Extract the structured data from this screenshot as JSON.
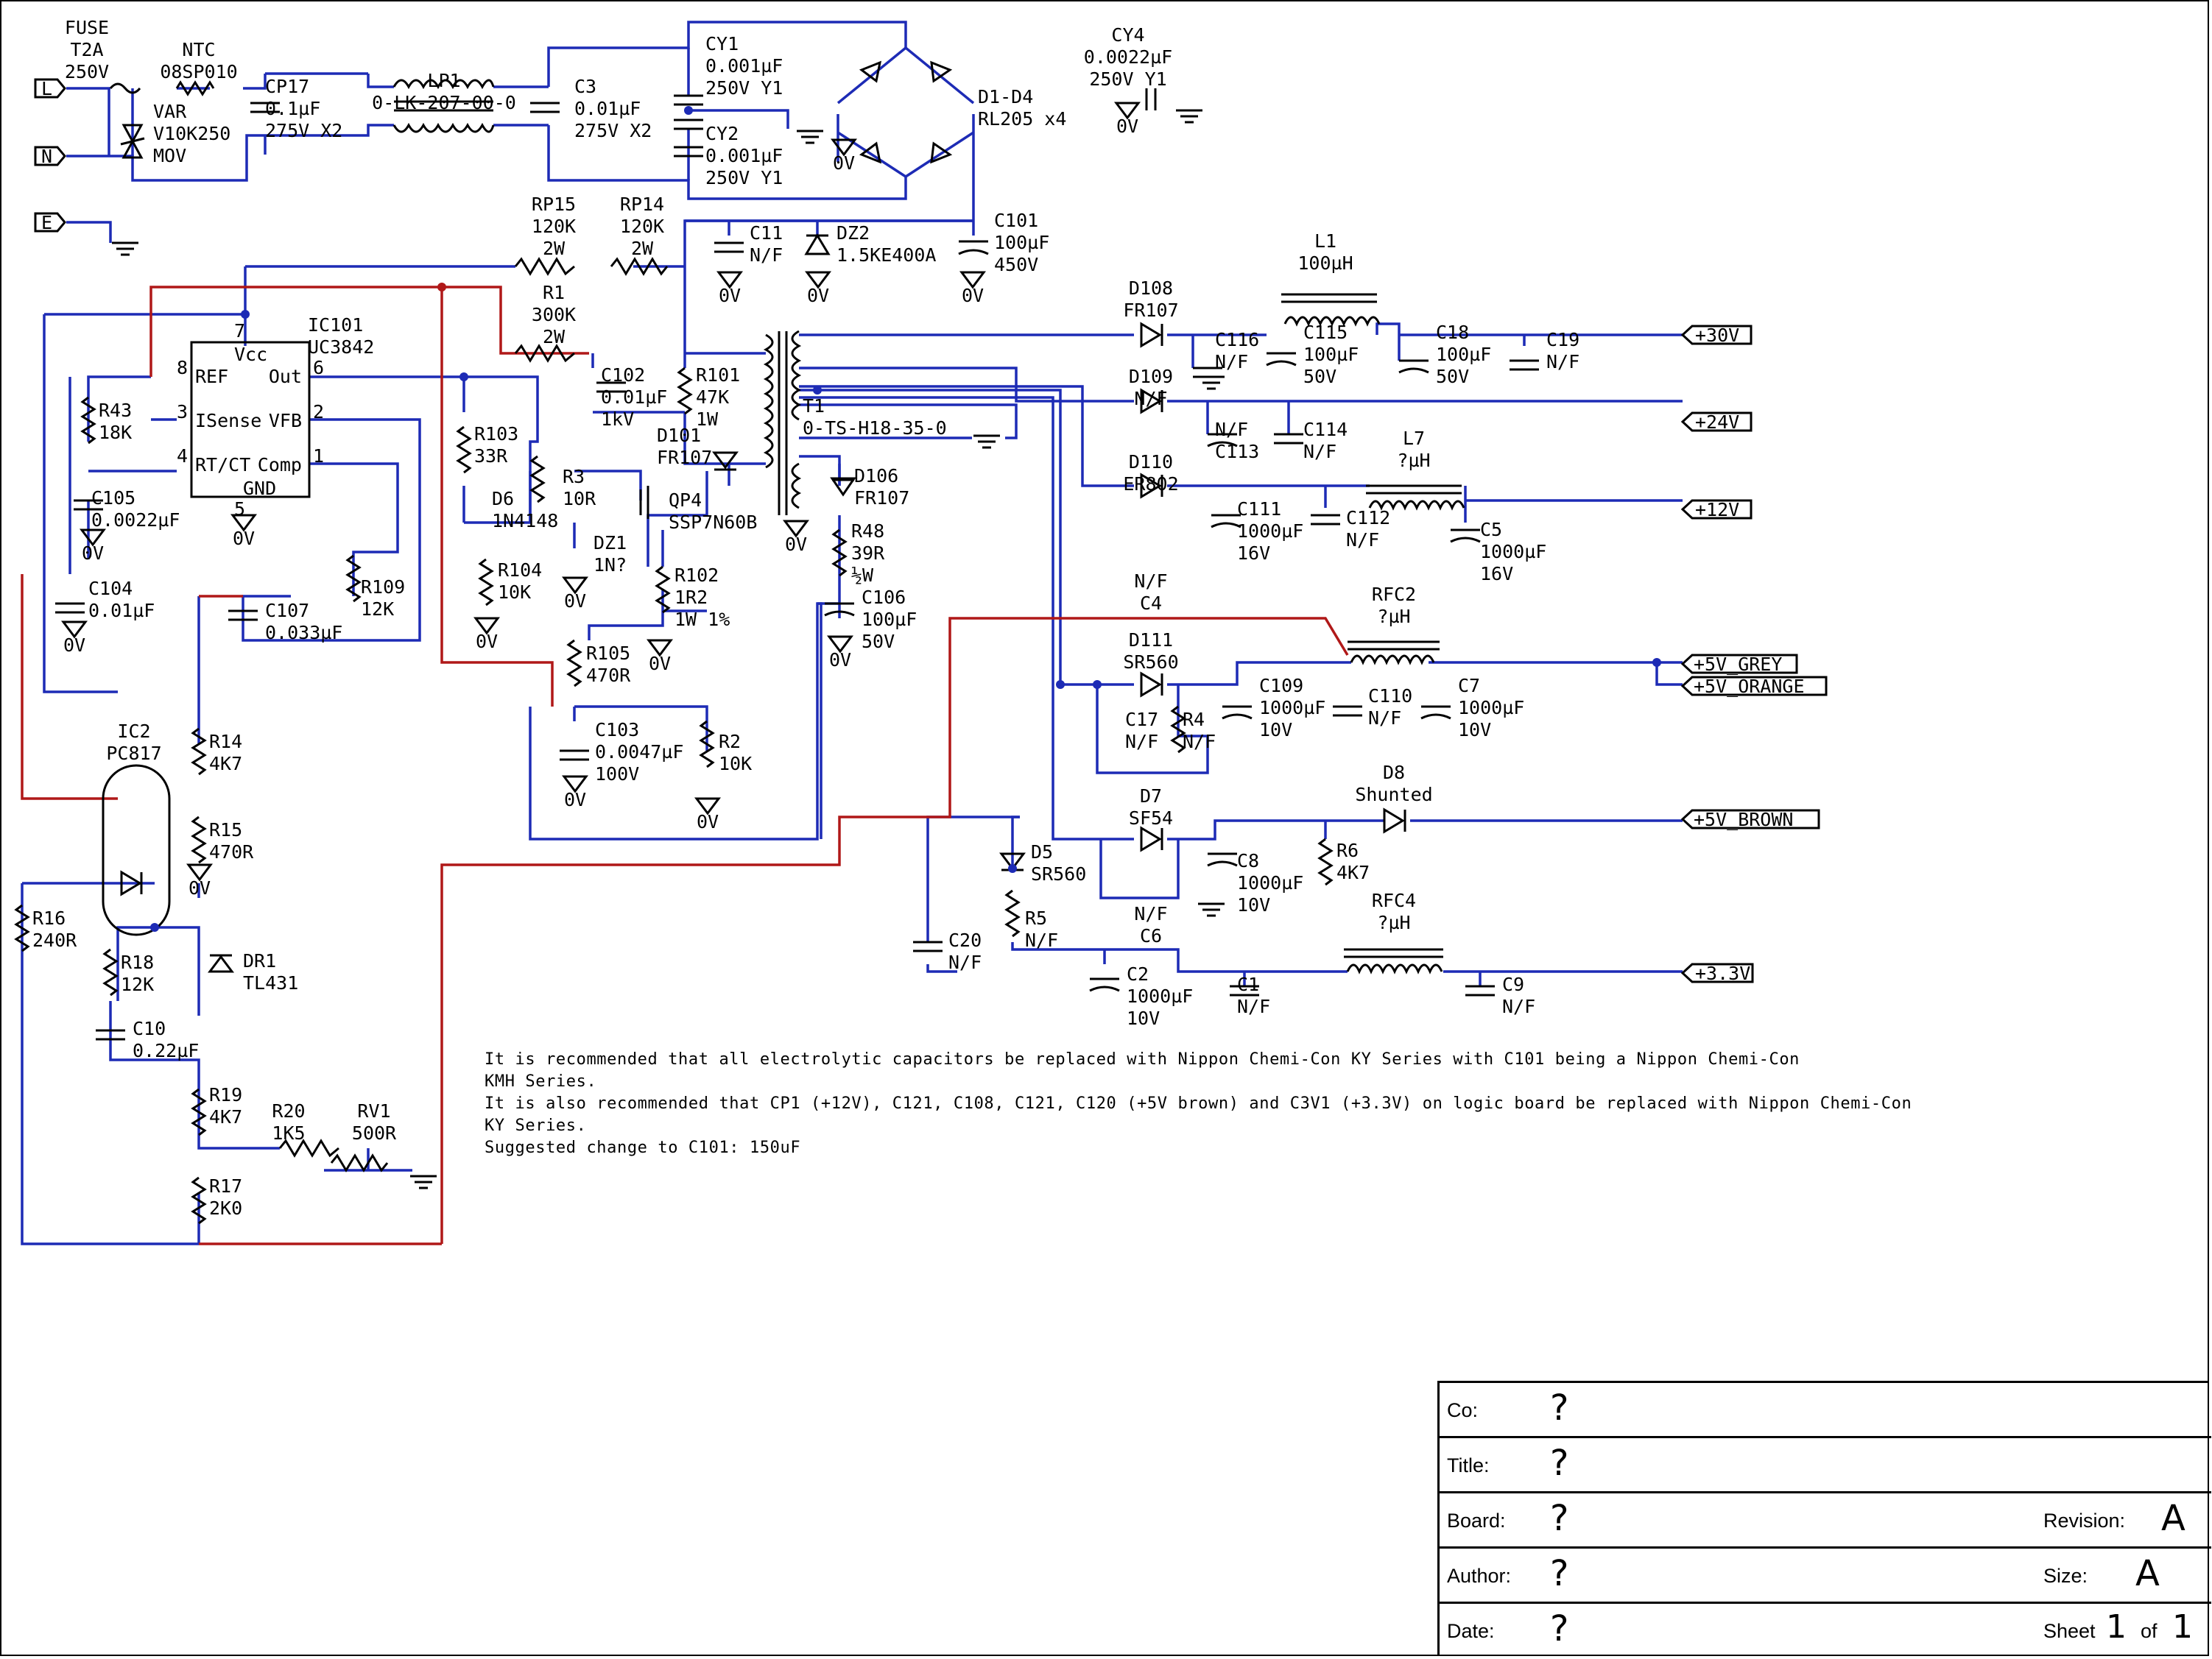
{
  "input": {
    "live": "L",
    "neutral": "N",
    "earth": "E"
  },
  "parts": {
    "fuse": [
      "FUSE",
      "T2A",
      "250V"
    ],
    "ntc": [
      "NTC",
      "08SP010"
    ],
    "var": [
      "VAR",
      "V10K250",
      "MOV"
    ],
    "cp17": [
      "CP17",
      "0.1µF",
      "275V X2"
    ],
    "lp1": [
      "LP1",
      "0-LK-207-00-0"
    ],
    "c3": [
      "C3",
      "0.01µF",
      "275V X2"
    ],
    "cy1": [
      "CY1",
      "0.001µF",
      "250V Y1"
    ],
    "cy2": [
      "CY2",
      "0.001µF",
      "250V Y1"
    ],
    "cy4": [
      "CY4",
      "0.0022µF",
      "250V Y1"
    ],
    "d1d4": [
      "D1-D4",
      "RL205 x4"
    ],
    "rp15": [
      "RP15",
      "120K",
      "2W"
    ],
    "rp14": [
      "RP14",
      "120K",
      "2W"
    ],
    "c11": [
      "C11",
      "N/F"
    ],
    "dz2": [
      "DZ2",
      "1.5KE400A"
    ],
    "c101": [
      "C101",
      "100µF",
      "450V"
    ],
    "r1": [
      "R1",
      "300K",
      "2W"
    ],
    "ic101": [
      "IC101",
      "UC3842"
    ],
    "ic_pins": [
      "Vcc",
      "REF",
      "Out",
      "ISense",
      "VFB",
      "RT/CT",
      "Comp",
      "GND",
      "7",
      "8",
      "6",
      "3",
      "2",
      "4",
      "1",
      "5"
    ],
    "r43": [
      "R43",
      "18K"
    ],
    "c105": [
      "C105",
      "0.0022µF"
    ],
    "c104": [
      "C104",
      "0.01µF"
    ],
    "c107": [
      "C107",
      "0.033µF"
    ],
    "r109": [
      "R109",
      "12K"
    ],
    "r103": [
      "R103",
      "33R"
    ],
    "d6": [
      "D6",
      "1N4148"
    ],
    "r3": [
      "R3",
      "10R"
    ],
    "r104": [
      "R104",
      "10K"
    ],
    "dz1": [
      "DZ1",
      "1N?"
    ],
    "c102": [
      "C102",
      "0.01µF",
      "1kV"
    ],
    "r101": [
      "R101",
      "47K",
      "1W"
    ],
    "d101": [
      "D101",
      "FR107"
    ],
    "qp4": [
      "QP4",
      "SSP7N60B"
    ],
    "r102": [
      "R102",
      "1R2",
      "1W 1%"
    ],
    "r105": [
      "R105",
      "470R"
    ],
    "c103": [
      "C103",
      "0.0047µF",
      "100V"
    ],
    "r2": [
      "R2",
      "10K"
    ],
    "t1": [
      "T1",
      "0-TS-H18-35-0"
    ],
    "d106": [
      "D106",
      "FR107"
    ],
    "r48": [
      "R48",
      "39R",
      "½W"
    ],
    "c106": [
      "C106",
      "100µF",
      "50V"
    ],
    "ic2": [
      "IC2",
      "PC817"
    ],
    "r14": [
      "R14",
      "4K7"
    ],
    "r15": [
      "R15",
      "470R"
    ],
    "r16": [
      "R16",
      "240R"
    ],
    "r18": [
      "R18",
      "12K"
    ],
    "c10": [
      "C10",
      "0.22µF"
    ],
    "dr1": [
      "DR1",
      "TL431"
    ],
    "r19": [
      "R19",
      "4K7"
    ],
    "r20": [
      "R20",
      "1K5"
    ],
    "rv1": [
      "RV1",
      "500R"
    ],
    "r17": [
      "R17",
      "2K0"
    ],
    "d108": [
      "D108",
      "FR107"
    ],
    "l1": [
      "L1",
      "100µH"
    ],
    "c116": [
      "C116",
      "N/F"
    ],
    "c115": [
      "C115",
      "100µF",
      "50V"
    ],
    "c18": [
      "C18",
      "100µF",
      "50V"
    ],
    "c19": [
      "C19",
      "N/F"
    ],
    "d109": [
      "D109",
      "N/F"
    ],
    "c113": [
      "N/F",
      "C113"
    ],
    "c114": [
      "C114",
      "N/F"
    ],
    "d110": [
      "D110",
      "ER802"
    ],
    "c4": [
      "N/F",
      "C4"
    ],
    "c111": [
      "C111",
      "1000µF",
      "16V"
    ],
    "c112": [
      "C112",
      "N/F"
    ],
    "l7": [
      "L7",
      "?µH"
    ],
    "c5": [
      "C5",
      "1000µF",
      "16V"
    ],
    "rfc2": [
      "RFC2",
      "?µH"
    ],
    "d111": [
      "D111",
      "SR560"
    ],
    "c17": [
      "C17",
      "N/F"
    ],
    "r4": [
      "R4",
      "N/F"
    ],
    "c109": [
      "C109",
      "1000µF",
      "10V"
    ],
    "c110": [
      "C110",
      "N/F"
    ],
    "c7": [
      "C7",
      "1000µF",
      "10V"
    ],
    "d8": [
      "D8",
      "Shunted"
    ],
    "d7": [
      "D7",
      "SF54"
    ],
    "c6": [
      "N/F",
      "C6"
    ],
    "c8": [
      "C8",
      "1000µF",
      "10V"
    ],
    "r6": [
      "R6",
      "4K7"
    ],
    "d5": [
      "D5",
      "SR560"
    ],
    "c20": [
      "C20",
      "N/F"
    ],
    "r5": [
      "R5",
      "N/F"
    ],
    "rfc4": [
      "RFC4",
      "?µH"
    ],
    "c2": [
      "C2",
      "1000µF",
      "10V"
    ],
    "c1": [
      "C1",
      "N/F"
    ],
    "c9": [
      "C9",
      "N/F"
    ]
  },
  "ground_label": "0V",
  "outputs": [
    "+30V",
    "+24V",
    "+12V",
    "+5V_GREY",
    "+5V_ORANGE",
    "+5V_BROWN",
    "+3.3V"
  ],
  "notes": [
    "It is recommended that all electrolytic capacitors be replaced with Nippon Chemi-Con KY Series with C101 being a Nippon Chemi-Con",
    "KMH Series.",
    "It is also recommended that CP1 (+12V), C121, C108, C121, C120 (+5V brown) and C3V1 (+3.3V) on logic board be replaced with Nippon Chemi-Con",
    "KY Series.",
    "Suggested change to C101: 150uF"
  ],
  "title_block": {
    "co_label": "Co:",
    "co_value": "?",
    "title_label": "Title:",
    "title_value": "?",
    "board_label": "Board:",
    "board_value": "?",
    "author_label": "Author:",
    "author_value": "?",
    "date_label": "Date:",
    "date_value": "?",
    "revision_label": "Revision:",
    "revision_value": "A",
    "size_label": "Size:",
    "size_value": "A",
    "sheet_label": "Sheet",
    "sheet_value": "1",
    "of_label": "of",
    "of_value": "1"
  },
  "colors": {
    "wire": "#1d2bb5",
    "feedback_wire": "#b01818",
    "ink": "#000000"
  }
}
